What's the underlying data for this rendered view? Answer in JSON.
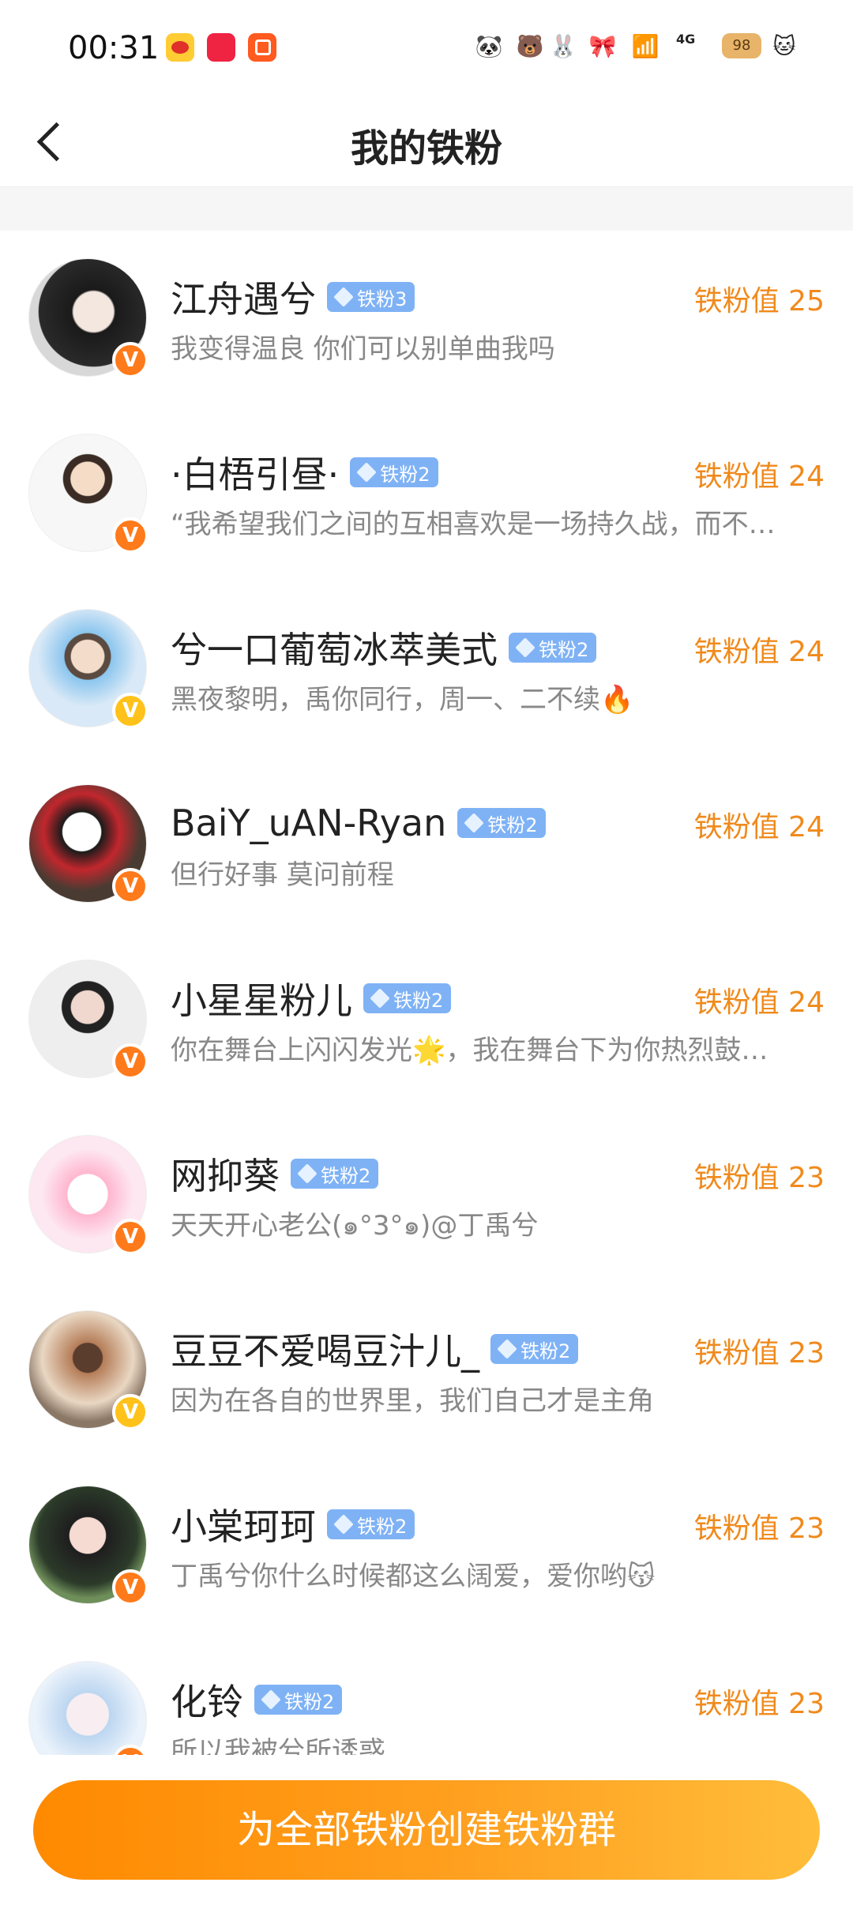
{
  "status_bar": {
    "time": "00:31",
    "network": "4G",
    "battery": "98"
  },
  "header": {
    "title": "我的铁粉"
  },
  "fans": [
    {
      "name": "江舟遇兮",
      "tag": "铁粉3",
      "score": "铁粉值 25",
      "bio": "我变得温良 你们可以别单曲我吗",
      "badge": "V",
      "badge_color": "#ff7a1a"
    },
    {
      "name": "·白梧引昼·",
      "tag": "铁粉2",
      "score": "铁粉值 24",
      "bio": "“我希望我们之间的互相喜欢是一场持久战，而不…",
      "badge": "V",
      "badge_color": "#ff7a1a"
    },
    {
      "name": "兮一口葡萄冰萃美式",
      "tag": "铁粉2",
      "score": "铁粉值 24",
      "bio": "黑夜黎明，禹你同行，周一、二不续🔥",
      "badge": "V",
      "badge_color": "#ffc21a"
    },
    {
      "name": "BaiY_uAN-Ryan",
      "tag": "铁粉2",
      "score": "铁粉值 24",
      "bio": "但行好事 莫问前程",
      "badge": "V",
      "badge_color": "#ff7a1a"
    },
    {
      "name": "小星星粉儿",
      "tag": "铁粉2",
      "score": "铁粉值 24",
      "bio": "你在舞台上闪闪发光🌟，我在舞台下为你热烈鼓…",
      "badge": "V",
      "badge_color": "#ff7a1a"
    },
    {
      "name": "网抑葵",
      "tag": "铁粉2",
      "score": "铁粉值 23",
      "bio": "天天开心老公(๑°3°๑)@丁禹兮",
      "badge": "V",
      "badge_color": "#ff7a1a"
    },
    {
      "name": "豆豆不爱喝豆汁儿_",
      "tag": "铁粉2",
      "score": "铁粉值 23",
      "bio": "因为在各自的世界里，我们自己才是主角",
      "badge": "V",
      "badge_color": "#ffc21a"
    },
    {
      "name": "小棠珂珂",
      "tag": "铁粉2",
      "score": "铁粉值 23",
      "bio": "丁禹兮你什么时候都这么阔爱，爱你哟😽",
      "badge": "V",
      "badge_color": "#ff7a1a"
    },
    {
      "name": "化铃",
      "tag": "铁粉2",
      "score": "铁粉值 23",
      "bio": "所以我被兮所诱惑",
      "badge": "V",
      "badge_color": "#ff7a1a"
    }
  ],
  "cta": {
    "label": "为全部铁粉创建铁粉群"
  },
  "colors": {
    "accent": "#f08a1c",
    "tag_blue": "#7fb2f5",
    "cta_start": "#ff8a00",
    "cta_end": "#ffbd3a"
  }
}
